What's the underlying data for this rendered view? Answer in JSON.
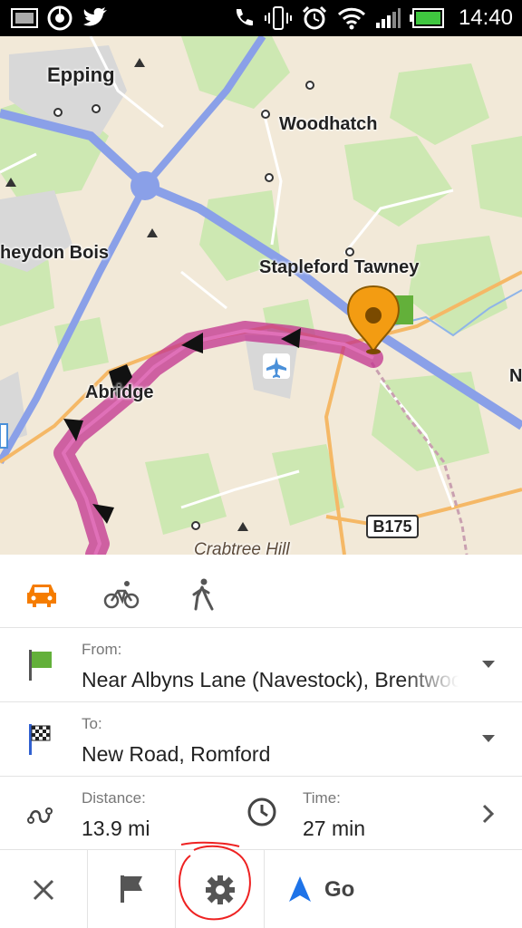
{
  "status_bar": {
    "time": "14:40",
    "icons": [
      "screenshot-icon",
      "chrome-icon",
      "twitter-icon",
      "call-icon",
      "vibrate-icon",
      "alarm-icon",
      "wifi-icon",
      "signal-icon",
      "battery-icon"
    ]
  },
  "map": {
    "places": [
      "Epping",
      "Woodhatch",
      "heydon Bois",
      "Stapleford Tawney",
      "Abridge",
      "Crabtree Hill",
      "N"
    ],
    "road_shield": "B175",
    "route_color": "#c2318f",
    "marker_color": "#f39c12"
  },
  "modes": {
    "selected": "car",
    "items": [
      "car",
      "bicycle",
      "walk"
    ],
    "accent": "#f57c00"
  },
  "route": {
    "from_label": "From:",
    "from_value": "Near Albyns Lane (Navestock), Brentwood",
    "to_label": "To:",
    "to_value": "New Road, Romford",
    "distance_label": "Distance:",
    "distance_value": "13.9 mi",
    "time_label": "Time:",
    "time_value": "27 min"
  },
  "actions": {
    "go_label": "Go",
    "go_color": "#1e73e8"
  }
}
